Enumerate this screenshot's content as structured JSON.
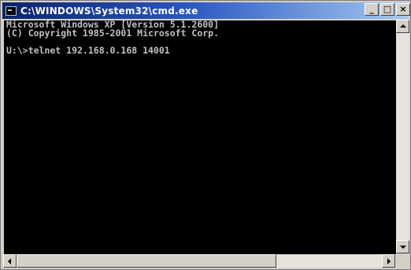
{
  "window": {
    "title": "C:\\WINDOWS\\System32\\cmd.exe",
    "controls": {
      "minimize": "_",
      "maximize": "□",
      "close": "×"
    }
  },
  "console": {
    "lines": [
      "Microsoft Windows XP [Version 5.1.2600]",
      "(C) Copyright 1985-2001 Microsoft Corp.",
      "",
      "U:\\>telnet 192.168.0.168 14001"
    ]
  },
  "colors": {
    "console_background": "#000000",
    "console_text": "#c0c0c0",
    "titlebar_start": "#0a246a",
    "titlebar_end": "#a6caf0"
  },
  "icons": {
    "app": "cmd-app-icon",
    "scroll_up": "arrow-up-icon",
    "scroll_down": "arrow-down-icon",
    "scroll_left": "arrow-left-icon",
    "scroll_right": "arrow-right-icon"
  }
}
